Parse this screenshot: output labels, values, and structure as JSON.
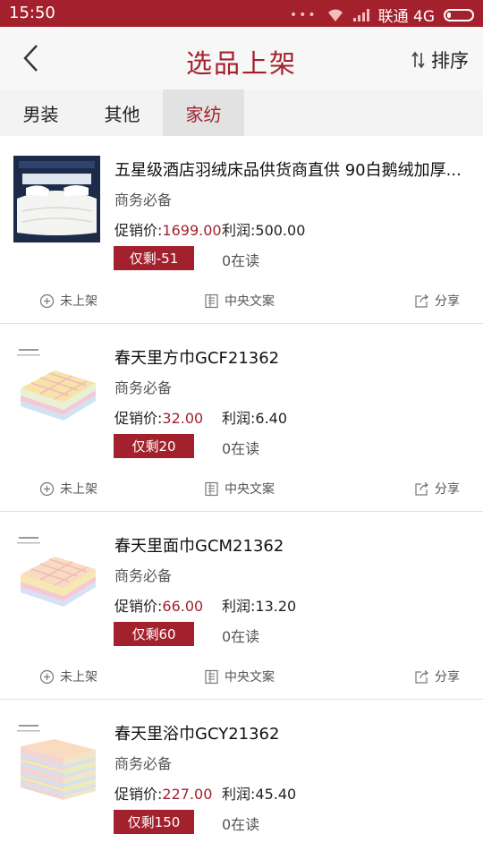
{
  "status_bar": {
    "time": "15:50",
    "carrier": "联通 4G",
    "dots": "•••"
  },
  "header": {
    "title": "选品上架",
    "sort_label": "排序"
  },
  "tabs": [
    {
      "label": "男装",
      "active": false
    },
    {
      "label": "其他",
      "active": false
    },
    {
      "label": "家纺",
      "active": true
    }
  ],
  "products": [
    {
      "name": "五星级酒店羽绒床品供货商直供 90白鹅绒加厚...",
      "tagline": "商务必备",
      "price_label": "促销价:",
      "price": "1699.00",
      "profit": "利润:500.00",
      "remain": "仅剩-51",
      "reads": "0在读",
      "image": "duvet-image"
    },
    {
      "name": "春天里方巾GCF21362",
      "tagline": "商务必备",
      "price_label": "促销价:",
      "price": "32.00",
      "profit": "利润:6.40",
      "remain": "仅剩20",
      "reads": "0在读",
      "image": "towel-image"
    },
    {
      "name": "春天里面巾GCM21362",
      "tagline": "商务必备",
      "price_label": "促销价:",
      "price": "66.00",
      "profit": "利润:13.20",
      "remain": "仅剩60",
      "reads": "0在读",
      "image": "towel-image"
    },
    {
      "name": "春天里浴巾GCY21362",
      "tagline": "商务必备",
      "price_label": "促销价:",
      "price": "227.00",
      "profit": "利润:45.40",
      "remain": "仅剩150",
      "reads": "0在读",
      "image": "towel-stack-image"
    }
  ],
  "actions": {
    "unlisted": "未上架",
    "central_copy": "中央文案",
    "share": "分享"
  },
  "colors": {
    "brand": "#a3212d",
    "background": "#f2f2f2"
  }
}
